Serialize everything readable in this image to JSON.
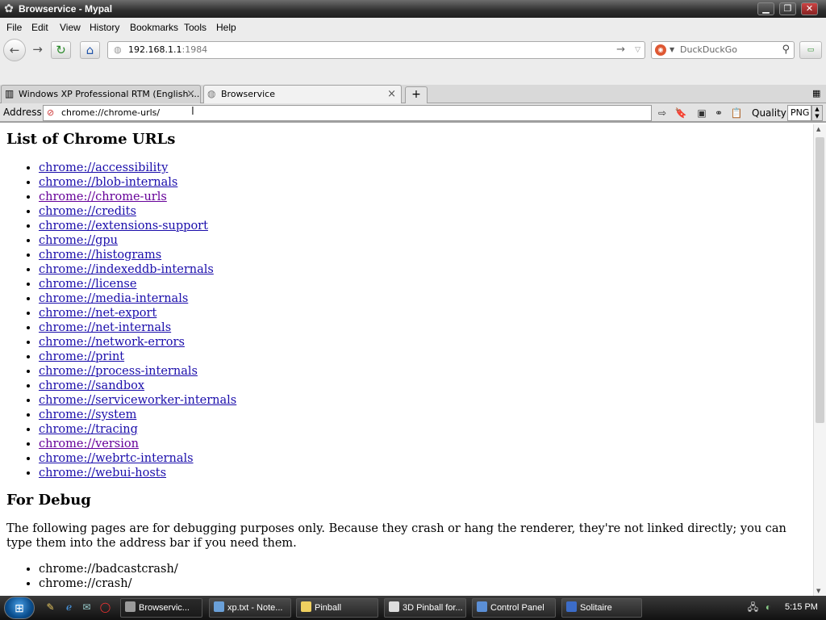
{
  "window": {
    "title": "Browservice - Mypal"
  },
  "menu": [
    "File",
    "Edit",
    "View",
    "History",
    "Bookmarks",
    "Tools",
    "Help"
  ],
  "navbar": {
    "url_domain": "192.168.1.1",
    "url_port": ":1984",
    "search_placeholder": "DuckDuckGo"
  },
  "tabs": [
    {
      "label": "Windows XP Professional RTM (English ..."
    },
    {
      "label": "Browservice"
    }
  ],
  "addressbar": {
    "label": "Address",
    "value": "chrome://chrome-urls/",
    "quality_label": "Quality",
    "quality_value": "PNG"
  },
  "page": {
    "heading": "List of Chrome URLs",
    "links": [
      {
        "text": "chrome://accessibility",
        "visited": false
      },
      {
        "text": "chrome://blob-internals",
        "visited": false
      },
      {
        "text": "chrome://chrome-urls",
        "visited": true
      },
      {
        "text": "chrome://credits",
        "visited": false
      },
      {
        "text": "chrome://extensions-support",
        "visited": false
      },
      {
        "text": "chrome://gpu",
        "visited": false
      },
      {
        "text": "chrome://histograms",
        "visited": false
      },
      {
        "text": "chrome://indexeddb-internals",
        "visited": false
      },
      {
        "text": "chrome://license",
        "visited": false
      },
      {
        "text": "chrome://media-internals",
        "visited": false
      },
      {
        "text": "chrome://net-export",
        "visited": false
      },
      {
        "text": "chrome://net-internals",
        "visited": false
      },
      {
        "text": "chrome://network-errors",
        "visited": false
      },
      {
        "text": "chrome://print",
        "visited": false
      },
      {
        "text": "chrome://process-internals",
        "visited": false
      },
      {
        "text": "chrome://sandbox",
        "visited": false
      },
      {
        "text": "chrome://serviceworker-internals",
        "visited": false
      },
      {
        "text": "chrome://system",
        "visited": false
      },
      {
        "text": "chrome://tracing",
        "visited": false
      },
      {
        "text": "chrome://version",
        "visited": true
      },
      {
        "text": "chrome://webrtc-internals",
        "visited": false
      },
      {
        "text": "chrome://webui-hosts",
        "visited": false
      }
    ],
    "debug_heading": "For Debug",
    "debug_text": "The following pages are for debugging purposes only. Because they crash or hang the renderer, they're not linked directly; you can type them into the address bar if you need them.",
    "debug_items": [
      "chrome://badcastcrash/",
      "chrome://crash/"
    ]
  },
  "taskbar": {
    "buttons": [
      {
        "label": "Browservic...",
        "color": "#9a9a9a"
      },
      {
        "label": "xp.txt - Note...",
        "color": "#6aa0d8"
      },
      {
        "label": "Pinball",
        "color": "#f0d060"
      },
      {
        "label": "3D Pinball for...",
        "color": "#dddddd"
      },
      {
        "label": "Control Panel",
        "color": "#5b8fd6"
      },
      {
        "label": "Solitaire",
        "color": "#3c6cc8"
      }
    ],
    "clock": "5:15 PM"
  },
  "colors": {
    "link": "#1a0dab",
    "visited": "#660099"
  }
}
